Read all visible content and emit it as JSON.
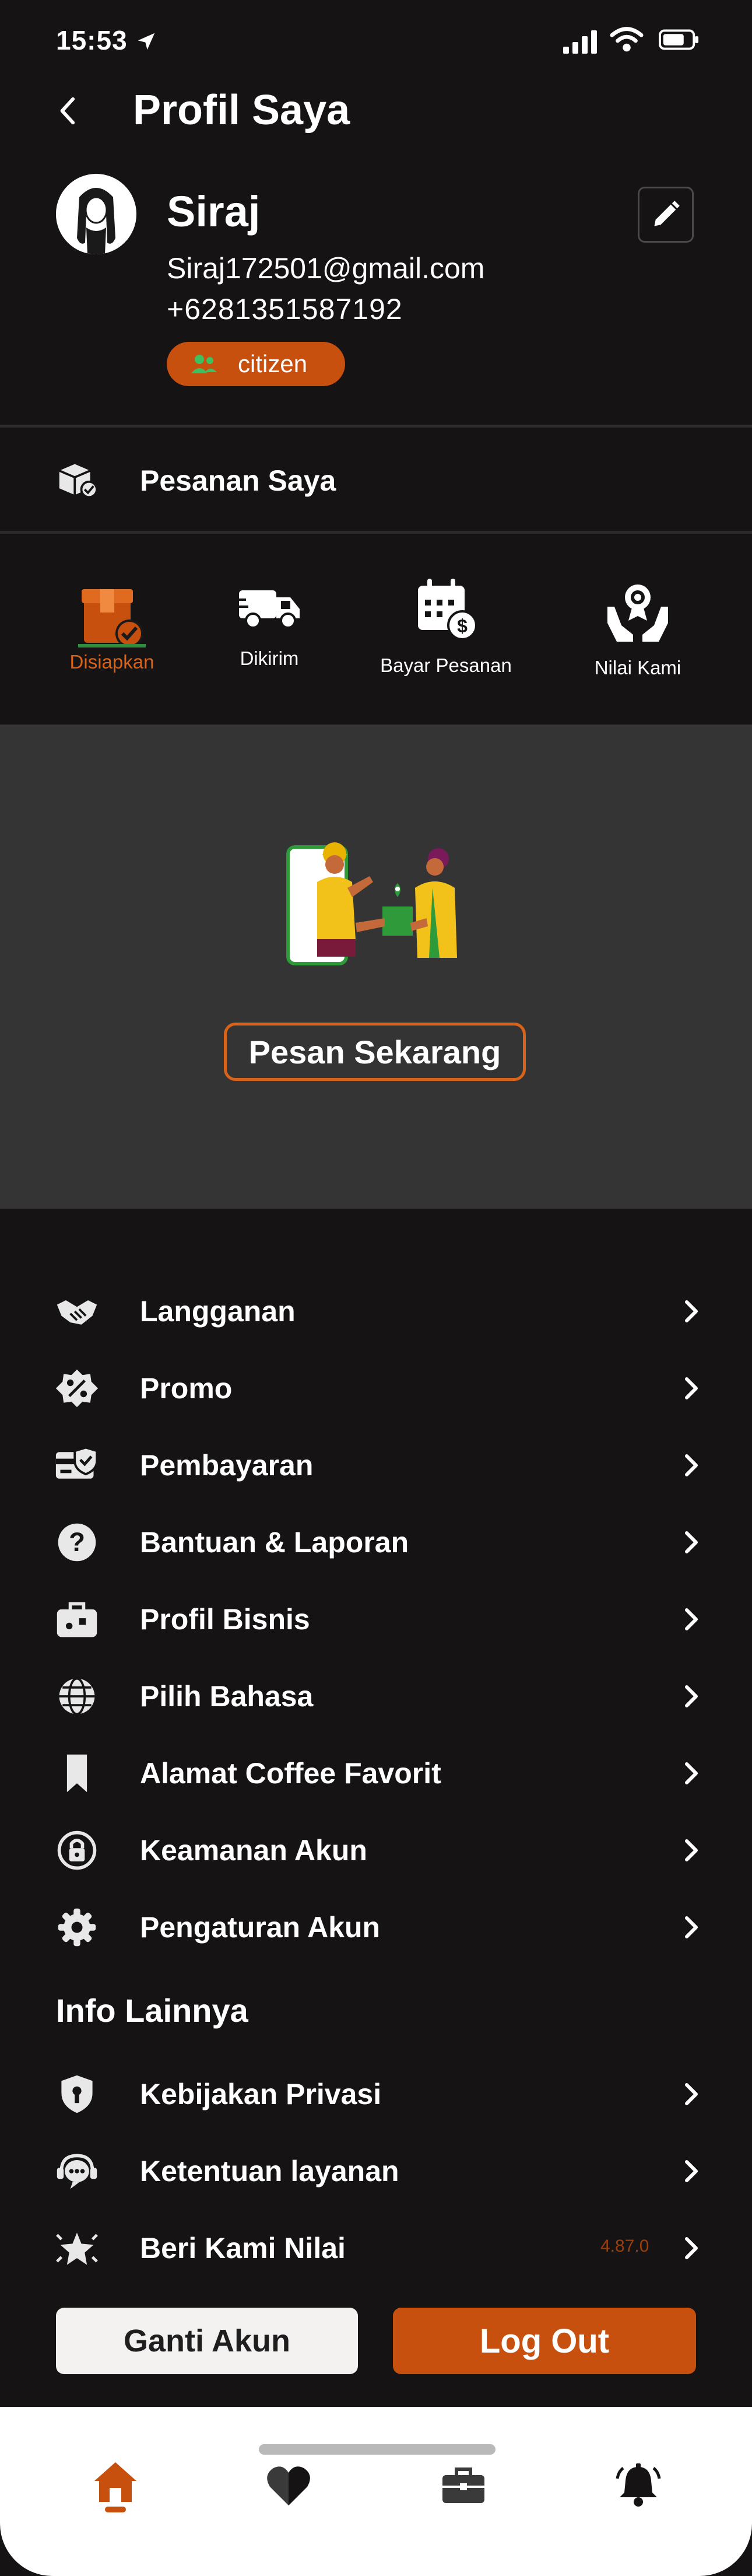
{
  "status_bar": {
    "time": "15:53"
  },
  "header": {
    "title": "Profil Saya"
  },
  "profile": {
    "name": "Siraj",
    "email": "Siraj172501@gmail.com",
    "phone": "+6281351587192",
    "role": "citizen"
  },
  "orders": {
    "label": "Pesanan Saya",
    "tabs": [
      {
        "label": "Disiapkan",
        "icon": "box-check-icon",
        "active": true
      },
      {
        "label": "Dikirim",
        "icon": "truck-icon",
        "active": false
      },
      {
        "label": "Bayar Pesanan",
        "icon": "calendar-dollar-icon",
        "active": false
      },
      {
        "label": "Nilai Kami",
        "icon": "award-hands-icon",
        "active": false
      }
    ]
  },
  "promo": {
    "button_label": "Pesan Sekarang"
  },
  "menu": [
    {
      "label": "Langganan",
      "icon": "handshake-icon"
    },
    {
      "label": "Promo",
      "icon": "percent-badge-icon"
    },
    {
      "label": "Pembayaran",
      "icon": "card-check-icon"
    },
    {
      "label": "Bantuan & Laporan",
      "icon": "question-icon"
    },
    {
      "label": "Profil Bisnis",
      "icon": "briefcase-icon"
    },
    {
      "label": "Pilih Bahasa",
      "icon": "globe-icon"
    },
    {
      "label": "Alamat Coffee Favorit",
      "icon": "bookmark-icon"
    },
    {
      "label": "Keamanan Akun",
      "icon": "lock-icon"
    },
    {
      "label": "Pengaturan Akun",
      "icon": "gear-icon"
    }
  ],
  "info_section": {
    "title": "Info Lainnya",
    "items": [
      {
        "label": "Kebijakan Privasi",
        "icon": "shield-lock-icon"
      },
      {
        "label": "Ketentuan layanan",
        "icon": "support-icon"
      },
      {
        "label": "Beri Kami Nilai",
        "icon": "star-icon"
      }
    ],
    "version": "4.87.0"
  },
  "actions": {
    "switch_account": "Ganti Akun",
    "logout": "Log Out"
  },
  "colors": {
    "background": "#151314",
    "accent": "#c8500f",
    "promo_bg": "#343434",
    "tabbar_bg": "#ffffff"
  }
}
